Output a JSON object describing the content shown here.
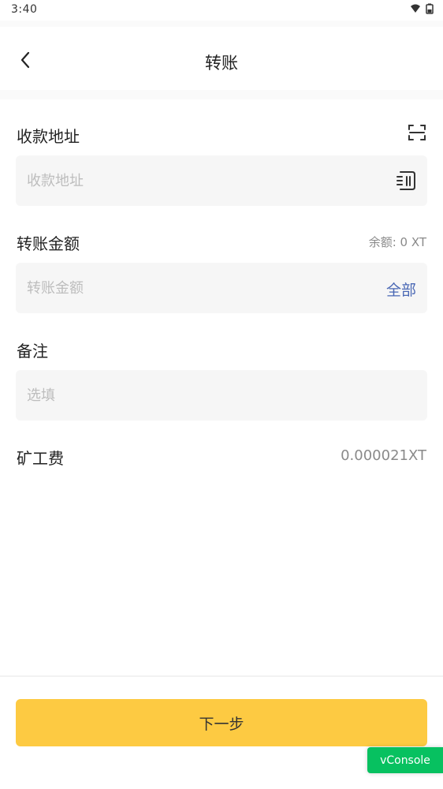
{
  "status_bar": {
    "time": "3:40",
    "icons": [
      "wifi-icon",
      "battery-icon"
    ]
  },
  "nav": {
    "back_icon": "chevron-left-icon",
    "title": "转账"
  },
  "form": {
    "address": {
      "label": "收款地址",
      "placeholder": "收款地址",
      "value": "",
      "scan_icon": "scan-icon",
      "address_book_icon": "address-book-icon"
    },
    "amount": {
      "label": "转账金额",
      "balance": "余额: 0 XT",
      "placeholder": "转账金额",
      "value": "",
      "all_label": "全部"
    },
    "memo": {
      "label": "备注",
      "placeholder": "选填",
      "value": ""
    },
    "fee": {
      "label": "矿工费",
      "value": "0.000021XT"
    }
  },
  "footer": {
    "next_label": "下一步"
  },
  "vconsole": {
    "label": "vConsole"
  },
  "colors": {
    "accent": "#fdca42",
    "link": "#4a68b5",
    "vconsole": "#07c160",
    "input_bg": "#f6f6f6"
  }
}
